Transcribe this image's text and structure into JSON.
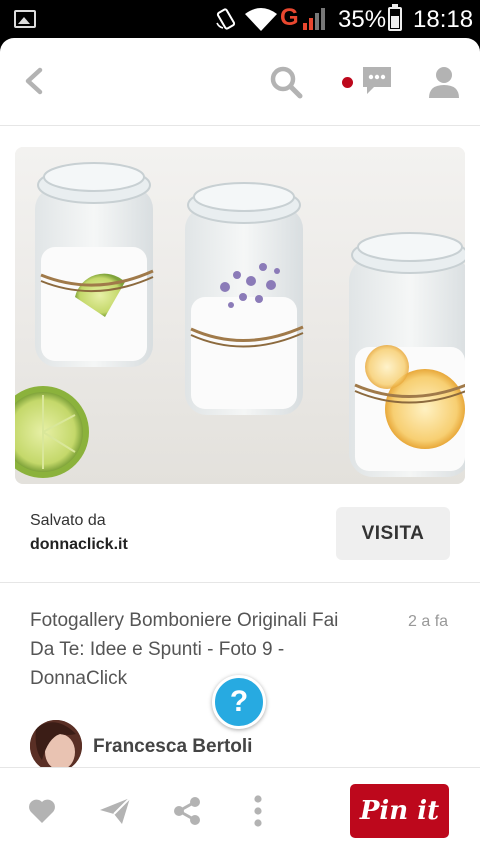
{
  "status_bar": {
    "network": "G",
    "battery": "35%",
    "time": "18:18",
    "icons": [
      "image-icon",
      "rotation-icon",
      "wifi-icon",
      "signal-icon",
      "battery-icon"
    ]
  },
  "top_bar": {
    "icons": [
      "back-arrow-icon",
      "search-icon",
      "notification-dot-icon",
      "chat-icon",
      "profile-icon"
    ],
    "colors": {
      "accent": "#bd081c",
      "icon": "#b3b3b3"
    }
  },
  "pin": {
    "saved_from_label": "Salvato da",
    "saved_from_site": "donnaclick.it",
    "visit_label": "VISITA",
    "description": "Fotogallery Bomboniere Originali Fai Da Te: Idee e Spunti - Foto 9 - DonnaClick",
    "age": "2 a fa",
    "author": "Francesca Bertoli"
  },
  "help_button": {
    "label": "?",
    "color": "#27aae1"
  },
  "bottom_bar": {
    "icons": [
      "heart-icon",
      "send-icon",
      "share-icon",
      "more-icon"
    ],
    "pin_it_label": "Pin it",
    "pin_it_color": "#bd081c"
  }
}
